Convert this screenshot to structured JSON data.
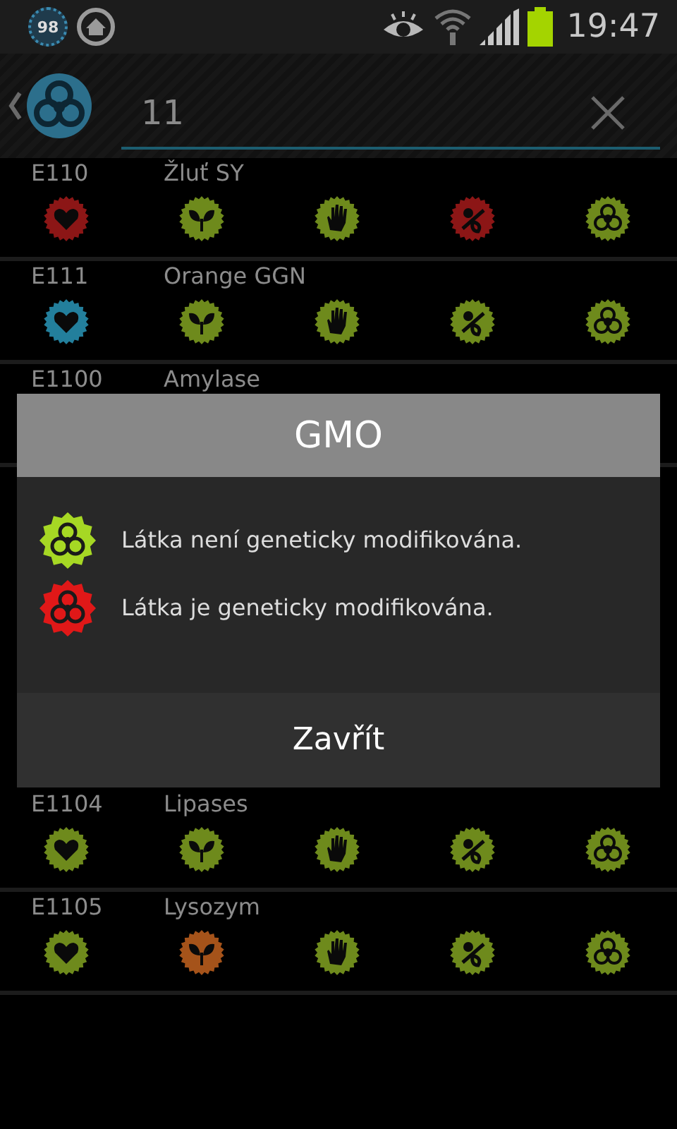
{
  "status_bar": {
    "notification_badge": "98",
    "time": "19:47"
  },
  "action_bar": {
    "search": {
      "value": "11"
    }
  },
  "rows_top": [
    {
      "code": "E110",
      "name": "Žluť SY",
      "badges": [
        {
          "kind": "heart",
          "color": "#8c1616"
        },
        {
          "kind": "leaf",
          "color": "#6e8a1c"
        },
        {
          "kind": "hand",
          "color": "#6e8a1c"
        },
        {
          "kind": "baby",
          "color": "#8c1616"
        },
        {
          "kind": "biohazard",
          "color": "#6e8a1c"
        }
      ]
    },
    {
      "code": "E111",
      "name": "Orange GGN",
      "badges": [
        {
          "kind": "heart",
          "color": "#237f9c"
        },
        {
          "kind": "leaf",
          "color": "#6e8a1c"
        },
        {
          "kind": "hand",
          "color": "#6e8a1c"
        },
        {
          "kind": "baby",
          "color": "#6e8a1c"
        },
        {
          "kind": "biohazard",
          "color": "#6e8a1c"
        }
      ]
    },
    {
      "code": "E1100",
      "name": "Amylase"
    }
  ],
  "rows_bottom": [
    {
      "code": "E1104",
      "name": "Lipases",
      "badges": [
        {
          "kind": "heart",
          "color": "#6e8a1c"
        },
        {
          "kind": "leaf",
          "color": "#6e8a1c"
        },
        {
          "kind": "hand",
          "color": "#6e8a1c"
        },
        {
          "kind": "baby",
          "color": "#6e8a1c"
        },
        {
          "kind": "biohazard",
          "color": "#6e8a1c"
        }
      ]
    },
    {
      "code": "E1105",
      "name": "Lysozym",
      "badges": [
        {
          "kind": "heart",
          "color": "#6e8a1c"
        },
        {
          "kind": "leaf",
          "color": "#a5531a"
        },
        {
          "kind": "hand",
          "color": "#6e8a1c"
        },
        {
          "kind": "baby",
          "color": "#6e8a1c"
        },
        {
          "kind": "biohazard",
          "color": "#6e8a1c"
        }
      ]
    }
  ],
  "dialog": {
    "title": "GMO",
    "legend": [
      {
        "color": "#a6d824",
        "text": "Látka není geneticky modifikována."
      },
      {
        "color": "#e01818",
        "text": "Látka je geneticky modifikována."
      }
    ],
    "close_button": "Zavřít"
  }
}
